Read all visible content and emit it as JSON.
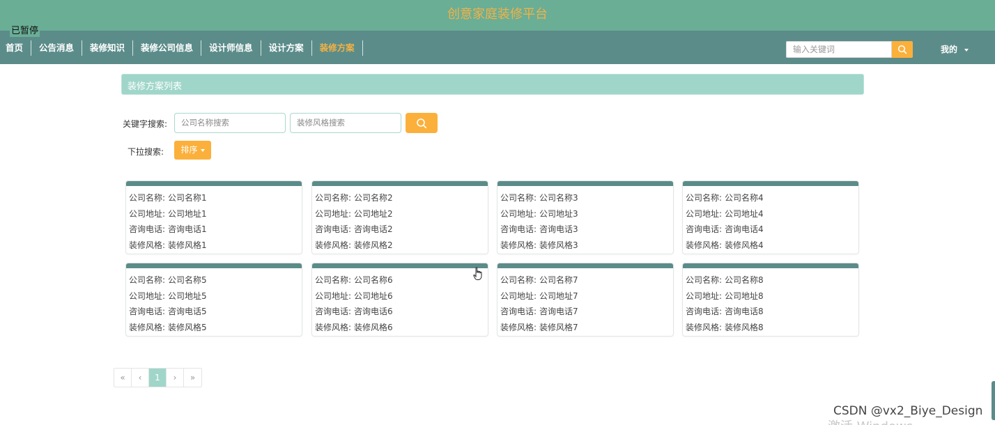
{
  "header": {
    "site_title": "创意家庭装修平台",
    "paused_label": "已暂停"
  },
  "nav": {
    "items": [
      "首页",
      "公告消息",
      "装修知识",
      "装修公司信息",
      "设计师信息",
      "设计方案",
      "装修方案"
    ],
    "active_index": 6
  },
  "top_search": {
    "placeholder": "输入关键词",
    "icon": "search-icon"
  },
  "user_menu": {
    "label": "我的",
    "icon": "caret-down-icon"
  },
  "section": {
    "title": "装修方案列表"
  },
  "filters": {
    "keyword_label": "关键字搜索:",
    "company_placeholder": "公司名称搜索",
    "style_placeholder": "装修风格搜索",
    "dropdown_label": "下拉搜索:",
    "sort_label": "排序"
  },
  "field_labels": {
    "company": "公司名称:",
    "address": "公司地址:",
    "phone": "咨询电话:",
    "style": "装修风格:"
  },
  "cards": [
    {
      "company": "公司名称1",
      "address": "公司地址1",
      "phone": "咨询电话1",
      "style": "装修风格1"
    },
    {
      "company": "公司名称2",
      "address": "公司地址2",
      "phone": "咨询电话2",
      "style": "装修风格2"
    },
    {
      "company": "公司名称3",
      "address": "公司地址3",
      "phone": "咨询电话3",
      "style": "装修风格3"
    },
    {
      "company": "公司名称4",
      "address": "公司地址4",
      "phone": "咨询电话4",
      "style": "装修风格4"
    },
    {
      "company": "公司名称5",
      "address": "公司地址5",
      "phone": "咨询电话5",
      "style": "装修风格5"
    },
    {
      "company": "公司名称6",
      "address": "公司地址6",
      "phone": "咨询电话6",
      "style": "装修风格6"
    },
    {
      "company": "公司名称7",
      "address": "公司地址7",
      "phone": "咨询电话7",
      "style": "装修风格7"
    },
    {
      "company": "公司名称8",
      "address": "公司地址8",
      "phone": "咨询电话8",
      "style": "装修风格8"
    }
  ],
  "pagination": {
    "first": "«",
    "prev": "‹",
    "current": "1",
    "next": "›",
    "last": "»"
  },
  "overlay": {
    "watermark": "CSDN @vx2_Biye_Design",
    "activate_windows": "激活 Windows"
  },
  "colors": {
    "header_bg": "#6aae96",
    "nav_bg": "#5b8c89",
    "accent": "#fbb03b",
    "title_text": "#f2b245",
    "section_bg": "#a0d6ca"
  }
}
